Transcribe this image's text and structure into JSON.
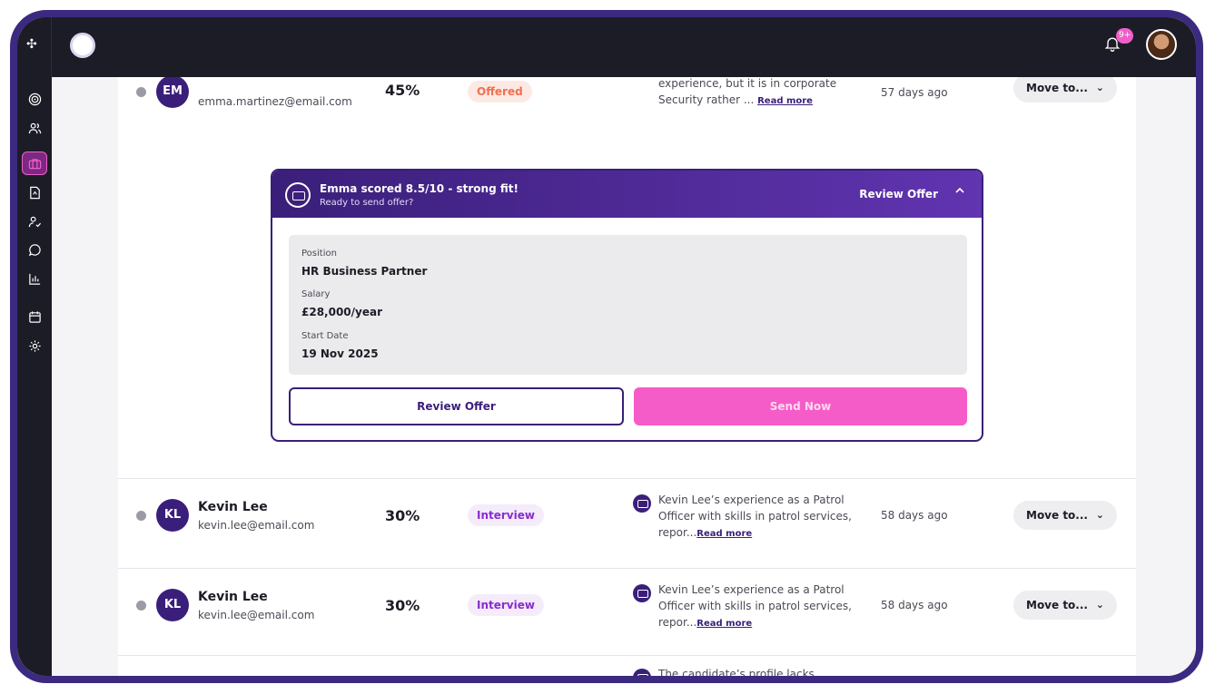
{
  "topbar": {
    "notification_count": "9+"
  },
  "rows": [
    {
      "initials": "EM",
      "email": "emma.martinez@email.com",
      "score": "45%",
      "status": "Offered",
      "summary": "experience, but it is in corporate Security rather ...",
      "read_more": "Read more",
      "age": "57 days ago",
      "move_to": "Move to..."
    },
    {
      "initials": "KL",
      "name": "Kevin Lee",
      "email": "kevin.lee@email.com",
      "score": "30%",
      "status": "Interview",
      "summary": "Kevin Lee’s experience as a Patrol Officer with skills in patrol services, repor...",
      "read_more": "Read more",
      "age": "58 days ago",
      "move_to": "Move to..."
    },
    {
      "initials": "KL",
      "name": "Kevin Lee",
      "email": "kevin.lee@email.com",
      "score": "30%",
      "status": "Interview",
      "summary": "Kevin Lee’s experience as a Patrol Officer with skills in patrol services, repor...",
      "read_more": "Read more",
      "age": "58 days ago",
      "move_to": "Move to..."
    },
    {
      "summary": "The candidate’s profile lacks essential"
    }
  ],
  "offer_panel": {
    "title": "Emma scored 8.5/10 - strong fit!",
    "subtitle": "Ready to send offer?",
    "header_action": "Review Offer",
    "position_label": "Position",
    "position_value": "HR Business Partner",
    "salary_label": "Salary",
    "salary_value": "£28,000/year",
    "start_label": "Start Date",
    "start_value": "19 Nov 2025",
    "review_button": "Review Offer",
    "send_button": "Send Now"
  },
  "colors": {
    "brand": "#3a1f7a",
    "accent": "#f65cc8",
    "sidebar": "#1c1c26"
  },
  "sidebar_icons": [
    "target-icon",
    "users-icon",
    "briefcase-icon",
    "document-icon",
    "user-check-icon",
    "chat-icon",
    "bar-chart-icon",
    "calendar-icon",
    "gear-icon"
  ]
}
